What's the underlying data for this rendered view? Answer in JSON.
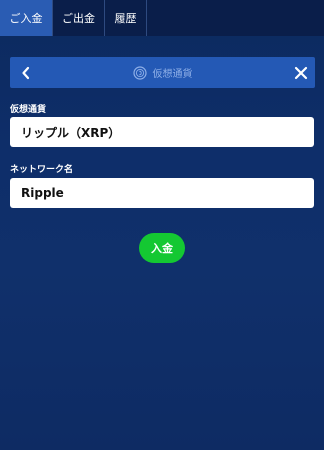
{
  "tabs": [
    {
      "label": "ご入金",
      "active": true
    },
    {
      "label": "ご出金",
      "active": false
    },
    {
      "label": "履歴",
      "active": false
    }
  ],
  "header": {
    "title": "仮想通貨",
    "back_icon": "chevron-left-icon",
    "close_icon": "close-icon",
    "title_icon": "coin-icon"
  },
  "fields": {
    "currency_label": "仮想通貨",
    "currency_value": "リップル（XRP）",
    "network_label": "ネットワーク名",
    "network_value": "Ripple"
  },
  "actions": {
    "deposit_label": "入金"
  },
  "colors": {
    "background": "#0e2e6a",
    "active_tab": "#2a5cb3",
    "header_bar": "#2459b5",
    "deposit_button": "#14c832"
  }
}
